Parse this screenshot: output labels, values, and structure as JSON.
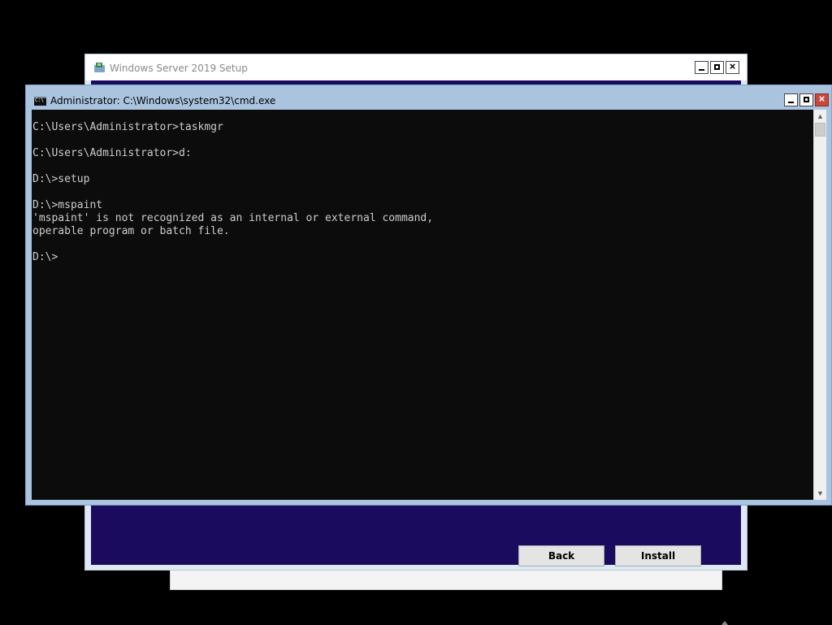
{
  "setup_window": {
    "title": "Windows Server 2019 Setup",
    "buttons": {
      "back": "Back",
      "install": "Install"
    }
  },
  "cmd_window": {
    "title": "Administrator: C:\\Windows\\system32\\cmd.exe",
    "console_lines": [
      "C:\\Users\\Administrator>taskmgr",
      "",
      "C:\\Users\\Administrator>d:",
      "",
      "D:\\>setup",
      "",
      "D:\\>mspaint",
      "'mspaint' is not recognized as an internal or external command,",
      "operable program or batch file.",
      "",
      "D:\\>"
    ]
  },
  "icons": {
    "minimize": "minimize-icon",
    "maximize": "maximize-icon",
    "close": "close-icon",
    "scroll_up": "chevron-up-icon",
    "scroll_down": "chevron-down-icon"
  },
  "colors": {
    "setup_background": "#1b0b5e",
    "console_background": "#0c0c0c",
    "console_text": "#cccccc",
    "cmd_frame": "#aac4e0",
    "close_button": "#c9483c"
  }
}
